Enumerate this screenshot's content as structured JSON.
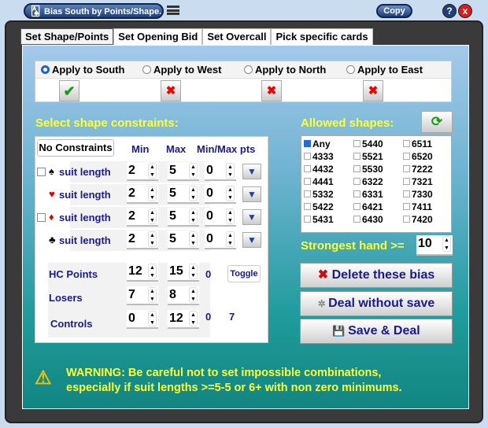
{
  "window": {
    "title": "Bias South by Points/Shape.",
    "copy_label": "Copy",
    "help_label": "?",
    "close_label": "x"
  },
  "tabs": [
    "Set Shape/Points",
    "Set Opening Bid",
    "Set Overcall",
    "Pick specific cards"
  ],
  "apply": {
    "options": [
      {
        "label": "Apply to South",
        "selected": true,
        "status": "check"
      },
      {
        "label": "Apply to West",
        "selected": false,
        "status": "x"
      },
      {
        "label": "Apply to North",
        "selected": false,
        "status": "x"
      },
      {
        "label": "Apply to East",
        "selected": false,
        "status": "x"
      }
    ]
  },
  "constraints": {
    "title": "Select shape constraints:",
    "no_constraints_label": "No Constraints",
    "headers": {
      "min": "Min",
      "max": "Max",
      "pts": "Min/Max pts"
    },
    "suits": [
      {
        "symbol": "♠",
        "color": "#000000",
        "label": "suit length",
        "min": "2",
        "max": "5",
        "pts": "0",
        "checkbox": true
      },
      {
        "symbol": "♥",
        "color": "#e00000",
        "label": "suit length",
        "min": "2",
        "max": "5",
        "pts": "0",
        "checkbox": false
      },
      {
        "symbol": "♦",
        "color": "#e00000",
        "label": "suit length",
        "min": "2",
        "max": "5",
        "pts": "0",
        "checkbox": true
      },
      {
        "symbol": "♣",
        "color": "#000000",
        "label": "suit length",
        "min": "2",
        "max": "5",
        "pts": "0",
        "checkbox": false
      }
    ],
    "hcp": {
      "label": "HC Points",
      "min": "12",
      "max": "15",
      "value": "0",
      "toggle_label": "Toggle"
    },
    "losers": {
      "label": "Losers",
      "min": "7",
      "max": "8"
    },
    "controls": {
      "label": "Controls",
      "min": "0",
      "max": "12",
      "value1": "0",
      "value2": "7"
    }
  },
  "shapes": {
    "title": "Allowed shapes:",
    "items": [
      {
        "label": "Any",
        "checked": true
      },
      {
        "label": "4333"
      },
      {
        "label": "4432"
      },
      {
        "label": "4441"
      },
      {
        "label": "5332"
      },
      {
        "label": "5422"
      },
      {
        "label": "5431"
      },
      {
        "label": "5440"
      },
      {
        "label": "5521"
      },
      {
        "label": "5530"
      },
      {
        "label": "6322"
      },
      {
        "label": "6331"
      },
      {
        "label": "6421"
      },
      {
        "label": "6430"
      },
      {
        "label": "6511"
      },
      {
        "label": "6520"
      },
      {
        "label": "7222"
      },
      {
        "label": "7321"
      },
      {
        "label": "7330"
      },
      {
        "label": "7411"
      },
      {
        "label": "7420"
      }
    ]
  },
  "strongest": {
    "label": "Strongest hand >=",
    "value": "10"
  },
  "actions": {
    "delete": "Delete these bias",
    "deal": "Deal without save",
    "save": "Save & Deal"
  },
  "warning": {
    "line1": "WARNING: Be careful not to set impossible combinations,",
    "line2": "especially if suit lengths >=5-5 or 6+ with non zero minimums."
  },
  "colors": {
    "accent_yellow": "#ffff33",
    "label_blue": "#1a1a8c"
  }
}
